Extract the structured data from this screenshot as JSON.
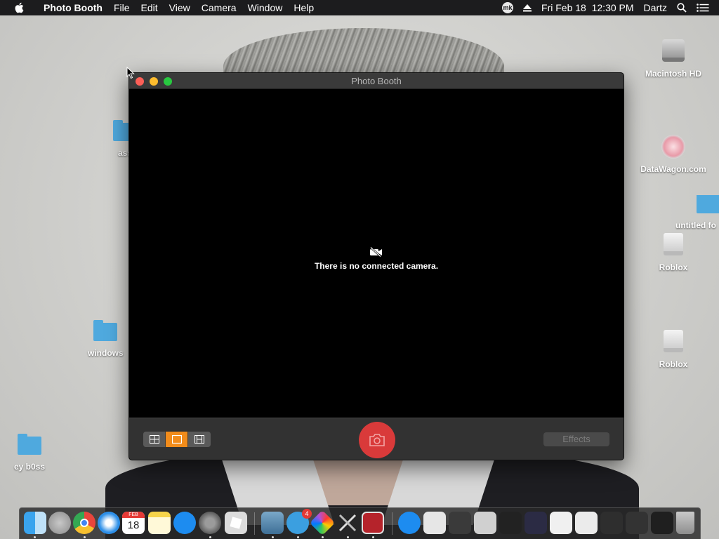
{
  "menubar": {
    "app_name": "Photo Booth",
    "menus": [
      "File",
      "Edit",
      "View",
      "Camera",
      "Window",
      "Help"
    ],
    "status_badge": "mk",
    "datetime": "Fri Feb 18  12:30 PM",
    "user": "Dartz"
  },
  "desktop_icons": {
    "left": [
      {
        "label": "ass",
        "kind": "folder"
      },
      {
        "label": "windows",
        "kind": "folder"
      },
      {
        "label": "ey b0ss",
        "kind": "folder"
      }
    ],
    "right": [
      {
        "label": "Macintosh HD",
        "kind": "hard-drive"
      },
      {
        "label": "DataWagon.com",
        "kind": "app-icon"
      },
      {
        "label": "untitled fo",
        "kind": "folder"
      },
      {
        "label": "Roblox",
        "kind": "drive"
      },
      {
        "label": "Roblox",
        "kind": "drive"
      }
    ]
  },
  "window": {
    "title": "Photo Booth",
    "message": "There is no connected camera.",
    "effects_label": "Effects",
    "layout_modes": [
      "four-up",
      "single",
      "movie"
    ],
    "active_layout": "single"
  },
  "dock": {
    "apps": [
      "finder-icon",
      "launchpad-icon",
      "chrome-icon",
      "safari-icon",
      "calendar-icon",
      "notes-icon",
      "app-store-icon",
      "system-preferences-icon",
      "roblox-icon",
      "preview-icon",
      "mk-icon",
      "color-picker-icon",
      "tools-icon",
      "photo-booth-icon",
      "app-store-icon",
      "thumbnail-1",
      "thumbnail-2",
      "thumbnail-3",
      "thumbnail-4",
      "thumbnail-5",
      "thumbnail-6",
      "thumbnail-7",
      "thumbnail-8",
      "thumbnail-9",
      "thumbnail-10",
      "trash-icon"
    ],
    "calendar_month": "FEB",
    "calendar_day": "18",
    "mk_badge": "4"
  },
  "colors": {
    "menubar": "#1c1c1e",
    "accent_orange": "#f28c1b",
    "shutter_red": "#d93a3a",
    "folder_blue": "#4fa9de"
  }
}
